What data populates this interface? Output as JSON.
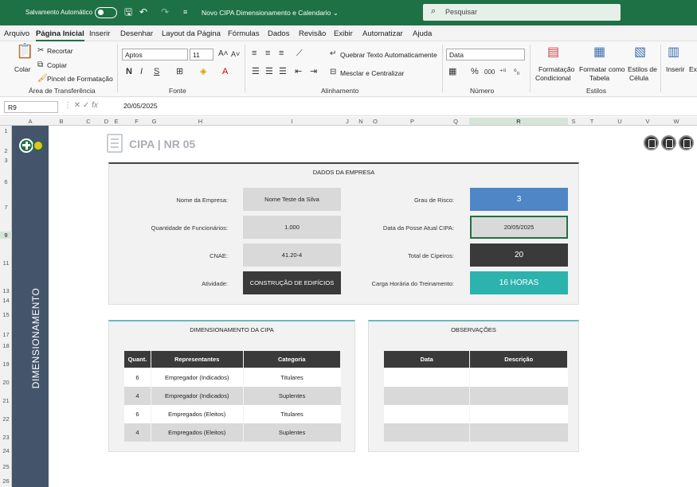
{
  "titlebar": {
    "autosave": "Salvamento Automático",
    "doc_title": "Novo CIPA Dimensionamento e Calendario",
    "search_placeholder": "Pesquisar"
  },
  "menu": [
    "Arquivo",
    "Página Inicial",
    "Inserir",
    "Desenhar",
    "Layout da Página",
    "Fórmulas",
    "Dados",
    "Revisão",
    "Exibir",
    "Automatizar",
    "Ajuda"
  ],
  "ribbon": {
    "paste": "Colar",
    "cut": "Recortar",
    "copy": "Copiar",
    "format_painter": "Pincel de Formatação",
    "group_clipboard": "Área de Transferência",
    "font_name": "Aptos",
    "font_size": "11",
    "group_font": "Fonte",
    "wrap_text": "Quebrar Texto Automaticamente",
    "merge_center": "Mesclar e Centralizar",
    "group_alignment": "Alinhamento",
    "number_format": "Data",
    "group_number": "Número",
    "cond_format_1": "Formatação",
    "cond_format_2": "Condicional",
    "format_table_1": "Formatar como",
    "format_table_2": "Tabela",
    "cell_styles_1": "Estilos de",
    "cell_styles_2": "Célula",
    "group_styles": "Estilos",
    "insert": "Inserir",
    "exclude": "Exc"
  },
  "formula_bar": {
    "name_box": "R9",
    "value": "20/05/2025"
  },
  "columns": [
    "A",
    "B",
    "C",
    "D",
    "E",
    "F",
    "G",
    "H",
    "I",
    "J",
    "N",
    "O",
    "P",
    "Q",
    "R",
    "S",
    "T",
    "U",
    "V",
    "W"
  ],
  "rows": [
    "1",
    "2",
    "3",
    "6",
    "7",
    "9",
    "11",
    "13",
    "14",
    "15",
    "17",
    "18",
    "19",
    "20",
    "21",
    "22",
    "23",
    "24",
    "25",
    "26"
  ],
  "sidebar": {
    "label": "DIMENSIONAMENTO"
  },
  "sheet": {
    "title": "CIPA | NR 05"
  },
  "company": {
    "header": "DADOS DA EMPRESA",
    "name_label": "Nome da Empresa:",
    "name_value": "Nome Teste da Silva",
    "employees_label": "Quantidade de Funcionários:",
    "employees_value": "1.000",
    "cnae_label": "CNAE:",
    "cnae_value": "41.20-4",
    "activity_label": "Atividade:",
    "activity_value": "CONSTRUÇÃO DE EDIFÍCIOS",
    "risk_label": "Grau de Risco:",
    "risk_value": "3",
    "posse_label": "Data da Posse Atual CIPA:",
    "posse_value": "20/05/2025",
    "cipeiros_label": "Total de Cipeiros:",
    "cipeiros_value": "20",
    "training_label": "Carga Horária do Treinamento:",
    "training_value": "16 HORAS"
  },
  "dimensioning": {
    "header": "DIMENSIONAMENTO DA CIPA",
    "columns": [
      "Quant.",
      "Representantes",
      "Categoria"
    ],
    "rows": [
      [
        "6",
        "Empregador (Indicados)",
        "Titulares"
      ],
      [
        "4",
        "Empregador (Indicados)",
        "Suplentes"
      ],
      [
        "6",
        "Empregados (Eleitos)",
        "Titulares"
      ],
      [
        "4",
        "Empregados (Eleitos)",
        "Suplentes"
      ]
    ]
  },
  "observations": {
    "header": "OBSERVAÇÕES",
    "columns": [
      "Data",
      "Descrição"
    ]
  },
  "colors": {
    "excel_green": "#1e7145",
    "sidebar": "#44546a",
    "risk_blue": "#4e86c6",
    "training_teal": "#2db3ad",
    "dark_cell": "#3a3a3a"
  }
}
